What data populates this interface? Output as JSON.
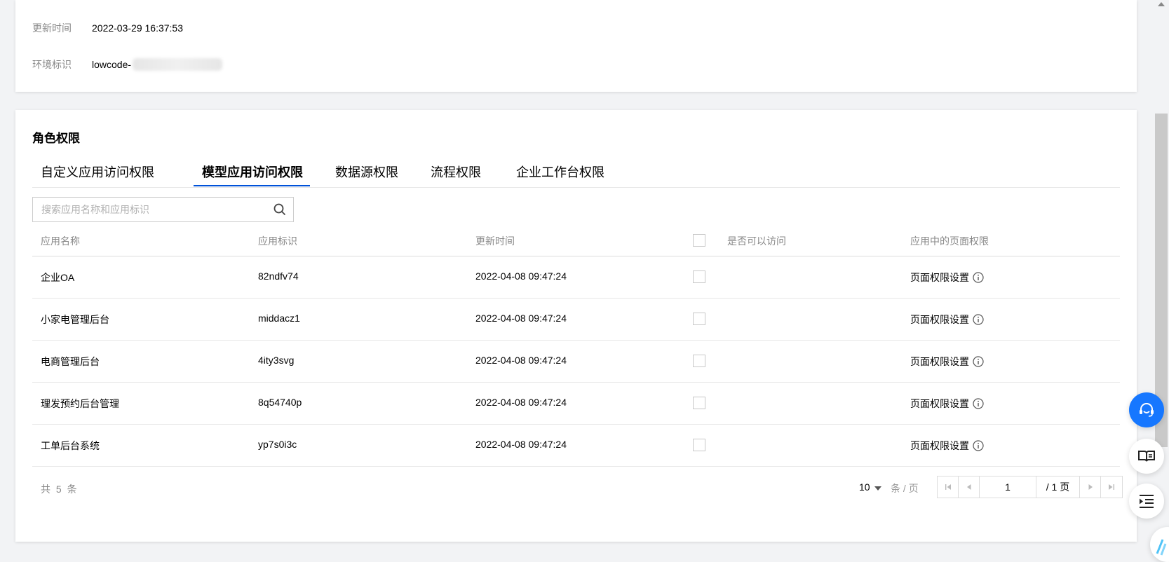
{
  "env_info": {
    "update_label": "更新时间",
    "update_value": "2022-03-29 16:37:53",
    "env_label": "环境标识",
    "env_value": "lowcode-"
  },
  "section_title": "角色权限",
  "tabs": [
    {
      "label": "自定义应用访问权限",
      "active": false
    },
    {
      "label": "模型应用访问权限",
      "active": true
    },
    {
      "label": "数据源权限",
      "active": false
    },
    {
      "label": "流程权限",
      "active": false
    },
    {
      "label": "企业工作台权限",
      "active": false
    }
  ],
  "search": {
    "placeholder": "搜索应用名称和应用标识",
    "value": ""
  },
  "table": {
    "headers": {
      "name": "应用名称",
      "id": "应用标识",
      "time": "更新时间",
      "access": "是否可以访问",
      "perm": "应用中的页面权限"
    },
    "rows": [
      {
        "name": "企业OA",
        "id": "82ndfv74",
        "time": "2022-04-08 09:47:24",
        "perm": "页面权限设置",
        "checked": false
      },
      {
        "name": "小家电管理后台",
        "id": "middacz1",
        "time": "2022-04-08 09:47:24",
        "perm": "页面权限设置",
        "checked": false
      },
      {
        "name": "电商管理后台",
        "id": "4ity3svg",
        "time": "2022-04-08 09:47:24",
        "perm": "页面权限设置",
        "checked": false
      },
      {
        "name": "理发预约后台管理",
        "id": "8q54740p",
        "time": "2022-04-08 09:47:24",
        "perm": "页面权限设置",
        "checked": false
      },
      {
        "name": "工单后台系统",
        "id": "yp7s0i3c",
        "time": "2022-04-08 09:47:24",
        "perm": "页面权限设置",
        "checked": false
      }
    ]
  },
  "pagination": {
    "total": "共 5 条",
    "page_size": "10",
    "per_page_label": "条 / 页",
    "current_page": "1",
    "total_pages": "/ 1 页"
  },
  "icons": {
    "search": "search-icon",
    "info": "info-circle-icon",
    "support": "headset-icon",
    "docs": "open-book-icon",
    "outline": "list-indent-icon"
  },
  "colors": {
    "accent": "#0052d9",
    "float_blue": "#1677ff"
  }
}
